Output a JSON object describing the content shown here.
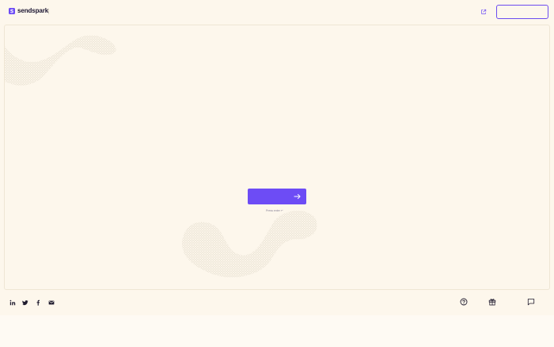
{
  "header": {
    "brand": "sendspark",
    "logo_icon": "sendspark-logo-icon",
    "external_link_icon": "external-link-icon",
    "top_button_label": ""
  },
  "main": {
    "cta_label": "",
    "cta_icon": "arrow-right-icon",
    "hint": "Press enter ↵"
  },
  "footer": {
    "social": [
      "linkedin-icon",
      "twitter-icon",
      "facebook-icon",
      "email-icon"
    ],
    "actions": [
      "help-icon",
      "gift-icon",
      "chat-icon"
    ]
  },
  "colors": {
    "background": "#fdf7ec",
    "accent": "#6d4cf5",
    "pattern": "#d9d1c2"
  }
}
